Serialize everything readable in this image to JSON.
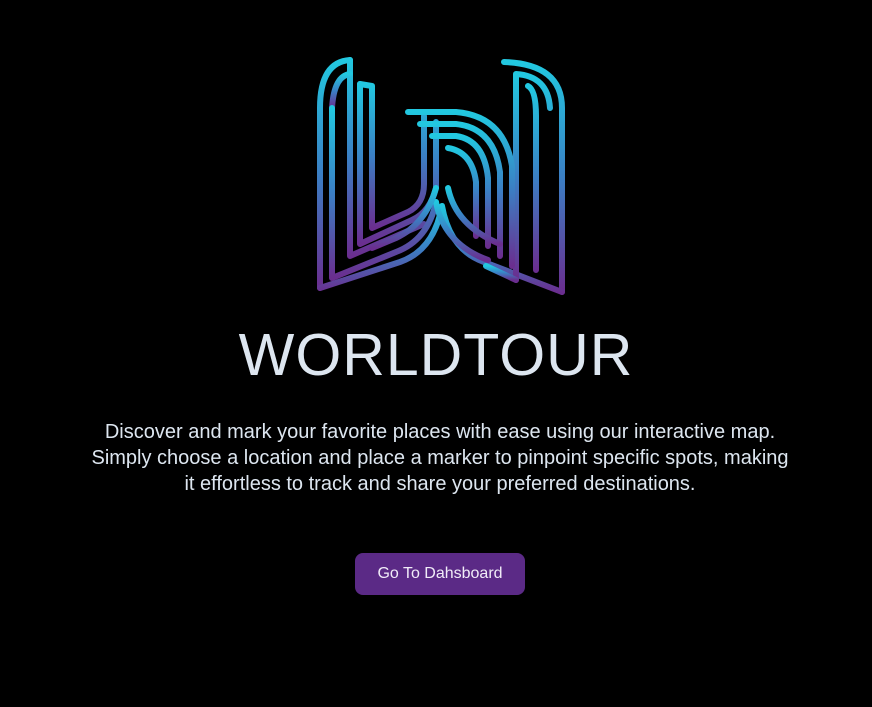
{
  "brand": {
    "logo_icon": "worldtour-w-logo-icon",
    "title": "WORLDTOUR",
    "gradient": {
      "top": "#22c8e0",
      "middle": "#3b7fc4",
      "bottom": "#6a2e8f"
    }
  },
  "hero": {
    "description": "Discover and mark your favorite places with ease using our interactive map. Simply choose a location and place a marker to pinpoint specific spots, making it effortless to track and share your preferred destinations."
  },
  "cta": {
    "label": "Go To Dahsboard",
    "color": "#5b2a86"
  },
  "colors": {
    "background": "#000000",
    "text": "#dde6f0"
  }
}
